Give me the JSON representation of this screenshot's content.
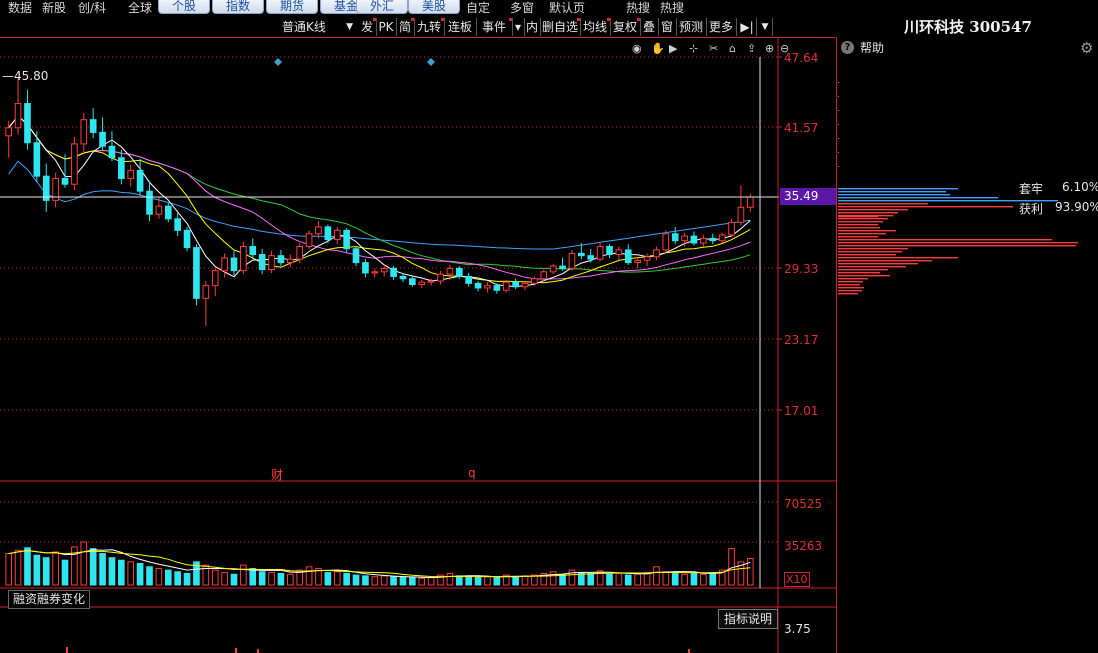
{
  "menu": {
    "plain_left": [
      "数据",
      "新股",
      "创/科",
      "全球"
    ],
    "tabs": [
      "个股",
      "指数",
      "期货",
      "基金",
      "外汇",
      "美股"
    ],
    "plain_right": [
      "自定",
      "多窗",
      "默认页",
      "热搜",
      "热搜"
    ]
  },
  "toolbar": {
    "kline_label": "普通K线",
    "buttons": [
      "发",
      "PK",
      "简",
      "九转",
      "连板",
      "事件",
      "",
      "内",
      "删自选",
      "均线",
      "复权",
      "叠",
      "窗",
      "预测",
      "更多"
    ]
  },
  "stock": {
    "name": "川环科技 300547"
  },
  "side": {
    "help": "帮助",
    "trapped_label": "套牢",
    "trapped_pct": "6.10%",
    "profit_label": "获利",
    "profit_pct": "93.90%"
  },
  "price_axis": {
    "labels": [
      "47.64",
      "41.57",
      "35.49",
      "29.33",
      "23.17",
      "17.01"
    ],
    "current": "35.49",
    "high_marker": "45.80"
  },
  "event_markers": {
    "fin": "财",
    "q": "q"
  },
  "volume_axis": {
    "labels": [
      "70525",
      "35263",
      "X10"
    ]
  },
  "sub_panel": {
    "label": "融资融券变化",
    "indicator_button": "指标说明",
    "axis_label": "3.75"
  },
  "colors": {
    "up": "#ff3b3b",
    "down": "#2ee6f0",
    "ma5": "#ffffff",
    "ma10": "#ffff00",
    "ma20": "#ff66ff",
    "ma30": "#33cc33",
    "ma60": "#3fa0ff",
    "axis_red": "#c8222e"
  },
  "chart_data": {
    "type": "candlestick",
    "ylim": [
      17.01,
      47.64
    ],
    "candles": [
      {
        "o": 40.8,
        "h": 42.1,
        "l": 38.9,
        "c": 41.5
      },
      {
        "o": 41.5,
        "h": 45.8,
        "l": 40.9,
        "c": 43.6
      },
      {
        "o": 43.6,
        "h": 44.8,
        "l": 39.6,
        "c": 40.2
      },
      {
        "o": 40.2,
        "h": 41.2,
        "l": 36.8,
        "c": 37.3
      },
      {
        "o": 37.3,
        "h": 38.4,
        "l": 34.2,
        "c": 35.2
      },
      {
        "o": 35.2,
        "h": 37.6,
        "l": 34.6,
        "c": 37.1
      },
      {
        "o": 37.1,
        "h": 39.2,
        "l": 36.3,
        "c": 36.6
      },
      {
        "o": 36.6,
        "h": 40.7,
        "l": 36.1,
        "c": 40.1
      },
      {
        "o": 40.1,
        "h": 42.8,
        "l": 39.2,
        "c": 42.2
      },
      {
        "o": 42.2,
        "h": 43.2,
        "l": 40.6,
        "c": 41.1
      },
      {
        "o": 41.1,
        "h": 42.4,
        "l": 39.5,
        "c": 39.9
      },
      {
        "o": 39.9,
        "h": 41.2,
        "l": 38.6,
        "c": 38.9
      },
      {
        "o": 38.9,
        "h": 39.6,
        "l": 36.6,
        "c": 37.1
      },
      {
        "o": 37.1,
        "h": 38.3,
        "l": 36.4,
        "c": 37.8
      },
      {
        "o": 37.8,
        "h": 38.8,
        "l": 35.6,
        "c": 36.0
      },
      {
        "o": 36.0,
        "h": 36.9,
        "l": 33.4,
        "c": 34.0
      },
      {
        "o": 34.0,
        "h": 35.5,
        "l": 33.6,
        "c": 34.7
      },
      {
        "o": 34.7,
        "h": 35.0,
        "l": 33.3,
        "c": 33.6
      },
      {
        "o": 33.6,
        "h": 34.1,
        "l": 32.1,
        "c": 32.6
      },
      {
        "o": 32.6,
        "h": 32.9,
        "l": 30.8,
        "c": 31.1
      },
      {
        "o": 31.1,
        "h": 31.4,
        "l": 26.1,
        "c": 26.7
      },
      {
        "o": 26.7,
        "h": 28.2,
        "l": 24.3,
        "c": 27.8
      },
      {
        "o": 27.8,
        "h": 29.4,
        "l": 26.9,
        "c": 29.1
      },
      {
        "o": 29.1,
        "h": 30.6,
        "l": 28.5,
        "c": 30.2
      },
      {
        "o": 30.2,
        "h": 30.8,
        "l": 28.7,
        "c": 29.1
      },
      {
        "o": 29.1,
        "h": 31.6,
        "l": 28.8,
        "c": 31.2
      },
      {
        "o": 31.2,
        "h": 31.9,
        "l": 30.1,
        "c": 30.5
      },
      {
        "o": 30.5,
        "h": 31.0,
        "l": 28.8,
        "c": 29.2
      },
      {
        "o": 29.2,
        "h": 30.8,
        "l": 28.9,
        "c": 30.4
      },
      {
        "o": 30.4,
        "h": 30.9,
        "l": 29.5,
        "c": 29.8
      },
      {
        "o": 29.8,
        "h": 30.5,
        "l": 29.4,
        "c": 30.1
      },
      {
        "o": 30.1,
        "h": 31.5,
        "l": 29.8,
        "c": 31.2
      },
      {
        "o": 31.2,
        "h": 32.6,
        "l": 31.0,
        "c": 32.3
      },
      {
        "o": 32.3,
        "h": 33.4,
        "l": 31.9,
        "c": 32.9
      },
      {
        "o": 32.9,
        "h": 33.1,
        "l": 31.5,
        "c": 31.8
      },
      {
        "o": 31.8,
        "h": 32.9,
        "l": 31.4,
        "c": 32.6
      },
      {
        "o": 32.6,
        "h": 32.8,
        "l": 30.7,
        "c": 31.0
      },
      {
        "o": 31.0,
        "h": 31.2,
        "l": 29.5,
        "c": 29.8
      },
      {
        "o": 29.8,
        "h": 30.1,
        "l": 28.5,
        "c": 28.9
      },
      {
        "o": 28.9,
        "h": 29.3,
        "l": 28.5,
        "c": 29.0
      },
      {
        "o": 29.0,
        "h": 29.6,
        "l": 28.6,
        "c": 29.3
      },
      {
        "o": 29.3,
        "h": 29.5,
        "l": 28.3,
        "c": 28.6
      },
      {
        "o": 28.6,
        "h": 28.9,
        "l": 28.1,
        "c": 28.4
      },
      {
        "o": 28.4,
        "h": 28.7,
        "l": 27.7,
        "c": 27.9
      },
      {
        "o": 27.9,
        "h": 28.3,
        "l": 27.6,
        "c": 28.1
      },
      {
        "o": 28.1,
        "h": 28.4,
        "l": 27.8,
        "c": 28.2
      },
      {
        "o": 28.2,
        "h": 29.1,
        "l": 27.9,
        "c": 28.8
      },
      {
        "o": 28.8,
        "h": 29.6,
        "l": 28.3,
        "c": 29.3
      },
      {
        "o": 29.3,
        "h": 29.5,
        "l": 28.4,
        "c": 28.6
      },
      {
        "o": 28.6,
        "h": 28.9,
        "l": 27.7,
        "c": 28.0
      },
      {
        "o": 28.0,
        "h": 28.2,
        "l": 27.3,
        "c": 27.6
      },
      {
        "o": 27.6,
        "h": 28.1,
        "l": 27.2,
        "c": 27.8
      },
      {
        "o": 27.8,
        "h": 28.0,
        "l": 27.1,
        "c": 27.4
      },
      {
        "o": 27.4,
        "h": 28.3,
        "l": 27.2,
        "c": 28.1
      },
      {
        "o": 28.1,
        "h": 28.4,
        "l": 27.5,
        "c": 27.7
      },
      {
        "o": 27.7,
        "h": 28.2,
        "l": 27.4,
        "c": 28.0
      },
      {
        "o": 28.0,
        "h": 28.6,
        "l": 27.8,
        "c": 28.4
      },
      {
        "o": 28.4,
        "h": 29.2,
        "l": 28.2,
        "c": 29.0
      },
      {
        "o": 29.0,
        "h": 29.7,
        "l": 28.8,
        "c": 29.5
      },
      {
        "o": 29.5,
        "h": 30.2,
        "l": 29.1,
        "c": 29.3
      },
      {
        "o": 29.3,
        "h": 30.9,
        "l": 29.1,
        "c": 30.6
      },
      {
        "o": 30.6,
        "h": 31.5,
        "l": 30.1,
        "c": 30.4
      },
      {
        "o": 30.4,
        "h": 31.0,
        "l": 29.8,
        "c": 30.1
      },
      {
        "o": 30.1,
        "h": 31.6,
        "l": 29.9,
        "c": 31.2
      },
      {
        "o": 31.2,
        "h": 31.4,
        "l": 30.2,
        "c": 30.5
      },
      {
        "o": 30.5,
        "h": 31.2,
        "l": 30.0,
        "c": 30.9
      },
      {
        "o": 30.9,
        "h": 31.4,
        "l": 29.6,
        "c": 29.8
      },
      {
        "o": 29.8,
        "h": 30.3,
        "l": 29.3,
        "c": 30.0
      },
      {
        "o": 30.0,
        "h": 30.6,
        "l": 29.5,
        "c": 30.3
      },
      {
        "o": 30.3,
        "h": 31.2,
        "l": 30.0,
        "c": 30.9
      },
      {
        "o": 30.9,
        "h": 32.6,
        "l": 30.6,
        "c": 32.3
      },
      {
        "o": 32.3,
        "h": 32.9,
        "l": 31.4,
        "c": 31.7
      },
      {
        "o": 31.7,
        "h": 32.4,
        "l": 31.2,
        "c": 32.1
      },
      {
        "o": 32.1,
        "h": 32.5,
        "l": 31.3,
        "c": 31.5
      },
      {
        "o": 31.5,
        "h": 32.2,
        "l": 31.2,
        "c": 31.9
      },
      {
        "o": 31.9,
        "h": 32.3,
        "l": 31.4,
        "c": 31.7
      },
      {
        "o": 31.7,
        "h": 32.4,
        "l": 31.5,
        "c": 32.2
      },
      {
        "o": 32.2,
        "h": 33.6,
        "l": 32.0,
        "c": 33.3
      },
      {
        "o": 33.3,
        "h": 36.5,
        "l": 33.0,
        "c": 34.6
      },
      {
        "o": 34.6,
        "h": 35.8,
        "l": 34.2,
        "c": 35.49
      }
    ],
    "volume": [
      38,
      42,
      45,
      36,
      33,
      40,
      30,
      46,
      52,
      44,
      38,
      33,
      30,
      28,
      26,
      22,
      20,
      18,
      16,
      14,
      28,
      24,
      18,
      15,
      13,
      24,
      20,
      16,
      15,
      14,
      13,
      18,
      22,
      20,
      15,
      16,
      14,
      12,
      11,
      10,
      11,
      10,
      9,
      9,
      8,
      9,
      12,
      14,
      11,
      10,
      9,
      10,
      9,
      12,
      10,
      11,
      12,
      14,
      16,
      13,
      18,
      15,
      14,
      17,
      13,
      14,
      12,
      13,
      15,
      22,
      16,
      15,
      13,
      14,
      13,
      15,
      18,
      44,
      28,
      32
    ],
    "volume_ylim": [
      0,
      70525
    ],
    "chip_distribution_label": [
      "套牢",
      "获利"
    ]
  }
}
